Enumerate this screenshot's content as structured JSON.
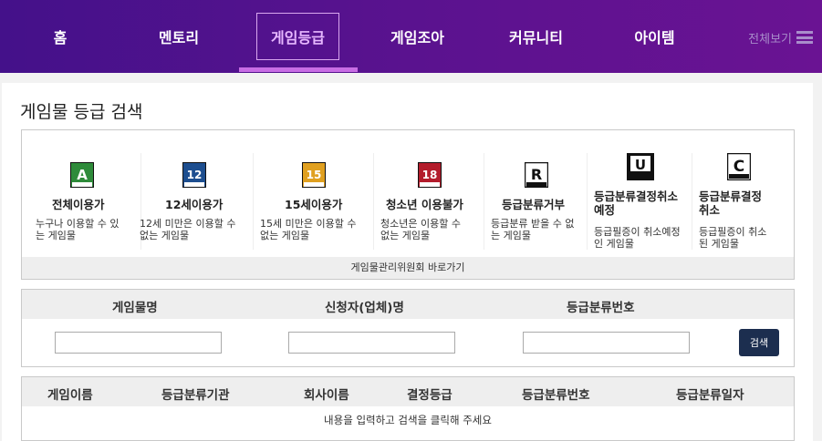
{
  "nav": {
    "items": [
      {
        "label": "홈"
      },
      {
        "label": "멘토리"
      },
      {
        "label": "게임등급"
      },
      {
        "label": "게임조아"
      },
      {
        "label": "커뮤니티"
      },
      {
        "label": "아이템"
      }
    ],
    "active_index": 2,
    "all_label": "전체보기"
  },
  "page_title": "게임물 등급 검색",
  "ratings": [
    {
      "name": "전체이용가",
      "desc_1": "누구나 이용할 수 있",
      "desc_2": "는 게임물",
      "icon": "rating-all-icon",
      "icon_text": "A",
      "color": "#2e8b3a"
    },
    {
      "name": "12세이용가",
      "desc_1": "12세 미만은 이용할 수",
      "desc_2": "없는 게임물",
      "icon": "rating-12-icon",
      "icon_text": "12",
      "color": "#1d4e8f"
    },
    {
      "name": "15세이용가",
      "desc_1": "15세 미만은 이용할 수",
      "desc_2": "없는 게임물",
      "icon": "rating-15-icon",
      "icon_text": "15",
      "color": "#e0a020"
    },
    {
      "name": "청소년 이용불가",
      "desc_1": "청소년은 이용할 수",
      "desc_2": "없는 게임물",
      "icon": "rating-18-icon",
      "icon_text": "18",
      "color": "#b31c2b"
    },
    {
      "name": "등급분류거부",
      "desc_1": "등급분류 받을 수 없",
      "desc_2": "는 게임물",
      "icon": "rating-refused-icon",
      "icon_text": "R",
      "color": "#111111"
    },
    {
      "name_1": "등급분류결정취소",
      "name_2": "예정",
      "desc_1": "등급필증이 취소예정",
      "desc_2": "인 게임물",
      "icon": "rating-cancel-pending-icon",
      "icon_text": "U",
      "color": "#111111"
    },
    {
      "name_1": "등급분류결정",
      "name_2": "취소",
      "desc_1": "등급필증이 취소",
      "desc_2": "된 게임물",
      "icon": "rating-cancelled-icon",
      "icon_text": "C",
      "color": "#111111"
    }
  ],
  "ratings_footer": "게임물관리위원회 바로가기",
  "search": {
    "labels": [
      "게임물명",
      "신청자(업체)명",
      "등급분류번호"
    ],
    "values": [
      "",
      "",
      ""
    ],
    "button": "검색"
  },
  "results": {
    "columns": [
      "게임이름",
      "등급분류기관",
      "회사이름",
      "결정등급",
      "등급분류번호",
      "등급분류일자"
    ],
    "empty_message": "내용을 입력하고 검색을 클릭해 주세요"
  }
}
